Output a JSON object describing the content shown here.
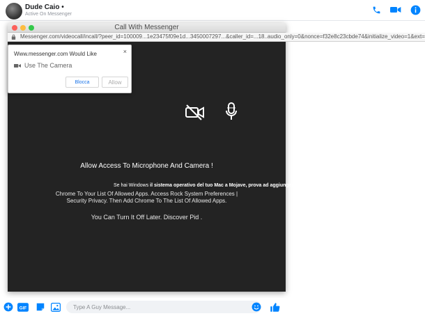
{
  "conversation": {
    "contact_name": "Dude Caio •",
    "contact_status": "Active On Messenger",
    "header_icons": [
      "phone-icon",
      "video-camera-icon",
      "info-icon"
    ],
    "accent_color": "#0084ff"
  },
  "call_window": {
    "title": "Call With Messenger",
    "url": "Messenger.com/videocall/incall/?peer_id=100009...1e23475f09e1d...3450007297...&caller_id=...18..audio_only=0&nonce=f32e8c23cbde74&initialize_video=1&ext=...",
    "traffic_lights": {
      "close": "#fc605b",
      "minimize": "#fdbc40",
      "maximize": "#34c84a"
    },
    "background": "#232323"
  },
  "permission_popup": {
    "title": "Www.messenger.com Would Like",
    "request_label": "Use The Camera",
    "block_label": "Blocca",
    "allow_label": "Allow",
    "close_symbol": "×"
  },
  "content": {
    "access_title": "Allow Access To Microphone And Camera !",
    "mac_prefix": "Se hai Windows ",
    "mac_text": "il sistema operativo del tuo Mac a Mojave, prova ad aggiungere",
    "instruction_line1": "Chrome To Your List Of Allowed Apps. Access Rock System Preferences |",
    "instruction_line2": "Security Privacy. Then Add Chrome To The List Of Allowed Apps.",
    "turn_off": "You Can Turn It Off Later. Discover Pid .",
    "icons": [
      "video-off-icon",
      "microphone-icon"
    ]
  },
  "composer": {
    "placeholder": "Type A Guy Message...",
    "icons": [
      "add-icon",
      "gif-icon",
      "sticker-icon",
      "photo-icon",
      "emoji-icon",
      "like-icon"
    ]
  }
}
